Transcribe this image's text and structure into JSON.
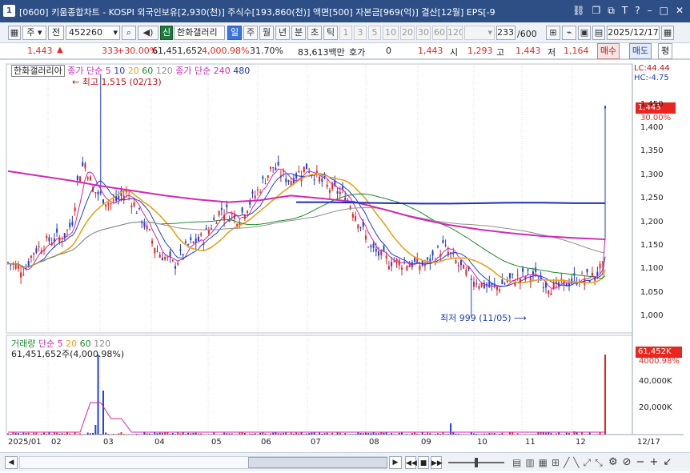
{
  "titlebar": {
    "window_num": "1",
    "title": "[0600] 키움종합차트 - KOSPI 외국인보유[2,930(천)] 주식수[193,860(천)] 액면[500] 자본금[969(억)] 결산[12월] EPS[-9",
    "icons": [
      "link-icon",
      "restore-icon",
      "copy-icon",
      "text-icon",
      "help-icon",
      "minimize-icon",
      "maximize-icon",
      "close-icon"
    ]
  },
  "toolbar": {
    "market_type": "주",
    "market_mode": "전",
    "code": "452260",
    "badge": "신",
    "stock_name": "한화갤러리",
    "periods": [
      "일",
      "주",
      "월",
      "년",
      "분",
      "초",
      "틱"
    ],
    "selected_period": "일",
    "intervals": [
      "1",
      "3",
      "5",
      "10",
      "20",
      "30",
      "60",
      "120"
    ],
    "count": "233",
    "count_total": "/600",
    "date": "2025/12/17"
  },
  "infobar": {
    "price": "1,443",
    "change": "333",
    "change_pct": "+30.00%",
    "volume": "61,451,652",
    "volume_pct": "4,000.98%",
    "turnover": "31.70%",
    "amount": "83,613백만",
    "quote_label": "호가",
    "quote": "0",
    "quote_price": "1,443",
    "open_label": "시",
    "open": "1,293",
    "high_label": "고",
    "high": "1,443",
    "low_label": "저",
    "low": "1,164",
    "buy_btn": "매수",
    "sell_btn": "매도",
    "eval_btn": "평"
  },
  "legend": {
    "stock_name": "한화갤러리아",
    "ma_label": "종가 단순",
    "ma_periods": [
      "5",
      "10",
      "20",
      "60",
      "120"
    ],
    "ma_label2": "종가 단순",
    "ma_periods2": [
      "240",
      "480"
    ],
    "vol_label": "거래량",
    "vol_ma_label": "단순",
    "vol_ma_periods": [
      "5",
      "20",
      "60",
      "120"
    ],
    "vol_info": "61,451,652주(4,000.98%)"
  },
  "annotations": {
    "high_note": "최고 1,515 (02/13)",
    "low_note": "최저 999 (11/05)",
    "lc": "LC:44.44",
    "hc": "HC:-4.75",
    "last_price_box": "1,443",
    "last_pct_box": "30.00%",
    "vol_box": "61,452K",
    "vol_pct_box": "4000.98%"
  },
  "axes": {
    "price_ticks": [
      "1,450",
      "1,400",
      "1,350",
      "1,300",
      "1,250",
      "1,200",
      "1,150",
      "1,100",
      "1,050",
      "1,000"
    ],
    "volume_ticks": [
      "40,000K",
      "20,000K"
    ],
    "date_labels": [
      "2025/01",
      "02",
      "03",
      "04",
      "05",
      "06",
      "07",
      "08",
      "09",
      "10",
      "11",
      "12",
      "12/17"
    ]
  },
  "colors": {
    "up": "#e8261f",
    "down": "#1f40d8",
    "ma5": "#e020a0",
    "ma10": "#1f40d8",
    "ma20": "#e9a21c",
    "ma60": "#1e8a2e",
    "ma120": "#909090",
    "ma240": "#d02ab8",
    "ma480": "#1830b8",
    "titlebar": "#2d4f86"
  },
  "chart_data": {
    "type": "candlestick",
    "series_ma": {
      "ma240": [
        1310,
        1300,
        1290,
        1278,
        1268,
        1258,
        1250,
        1244,
        1248,
        1258,
        1252,
        1245,
        1228,
        1210,
        1196,
        1186,
        1178,
        1172,
        1168,
        1165
      ],
      "ma480": [
        1244,
        1244,
        1243,
        1242,
        1241,
        1241,
        1242,
        1243,
        1243,
        1242,
        1242
      ]
    },
    "price_range": [
      990,
      1520
    ],
    "last_close": 1443,
    "high": 1515,
    "high_date": "02/13",
    "low": 999,
    "low_date": "11/05",
    "last_volume": 61451652
  },
  "scrollbar": {
    "buttons": [
      "play-icon",
      "prev-icon",
      "stop-icon",
      "next-icon",
      "zoom-slider",
      "table-icon",
      "grid-icon",
      "chart-icon",
      "measure-icon",
      "tool1-icon",
      "tool2-icon",
      "tool3-icon",
      "tool4-icon",
      "tool5-icon",
      "minus-icon",
      "plus-icon",
      "arrow-icon"
    ]
  }
}
